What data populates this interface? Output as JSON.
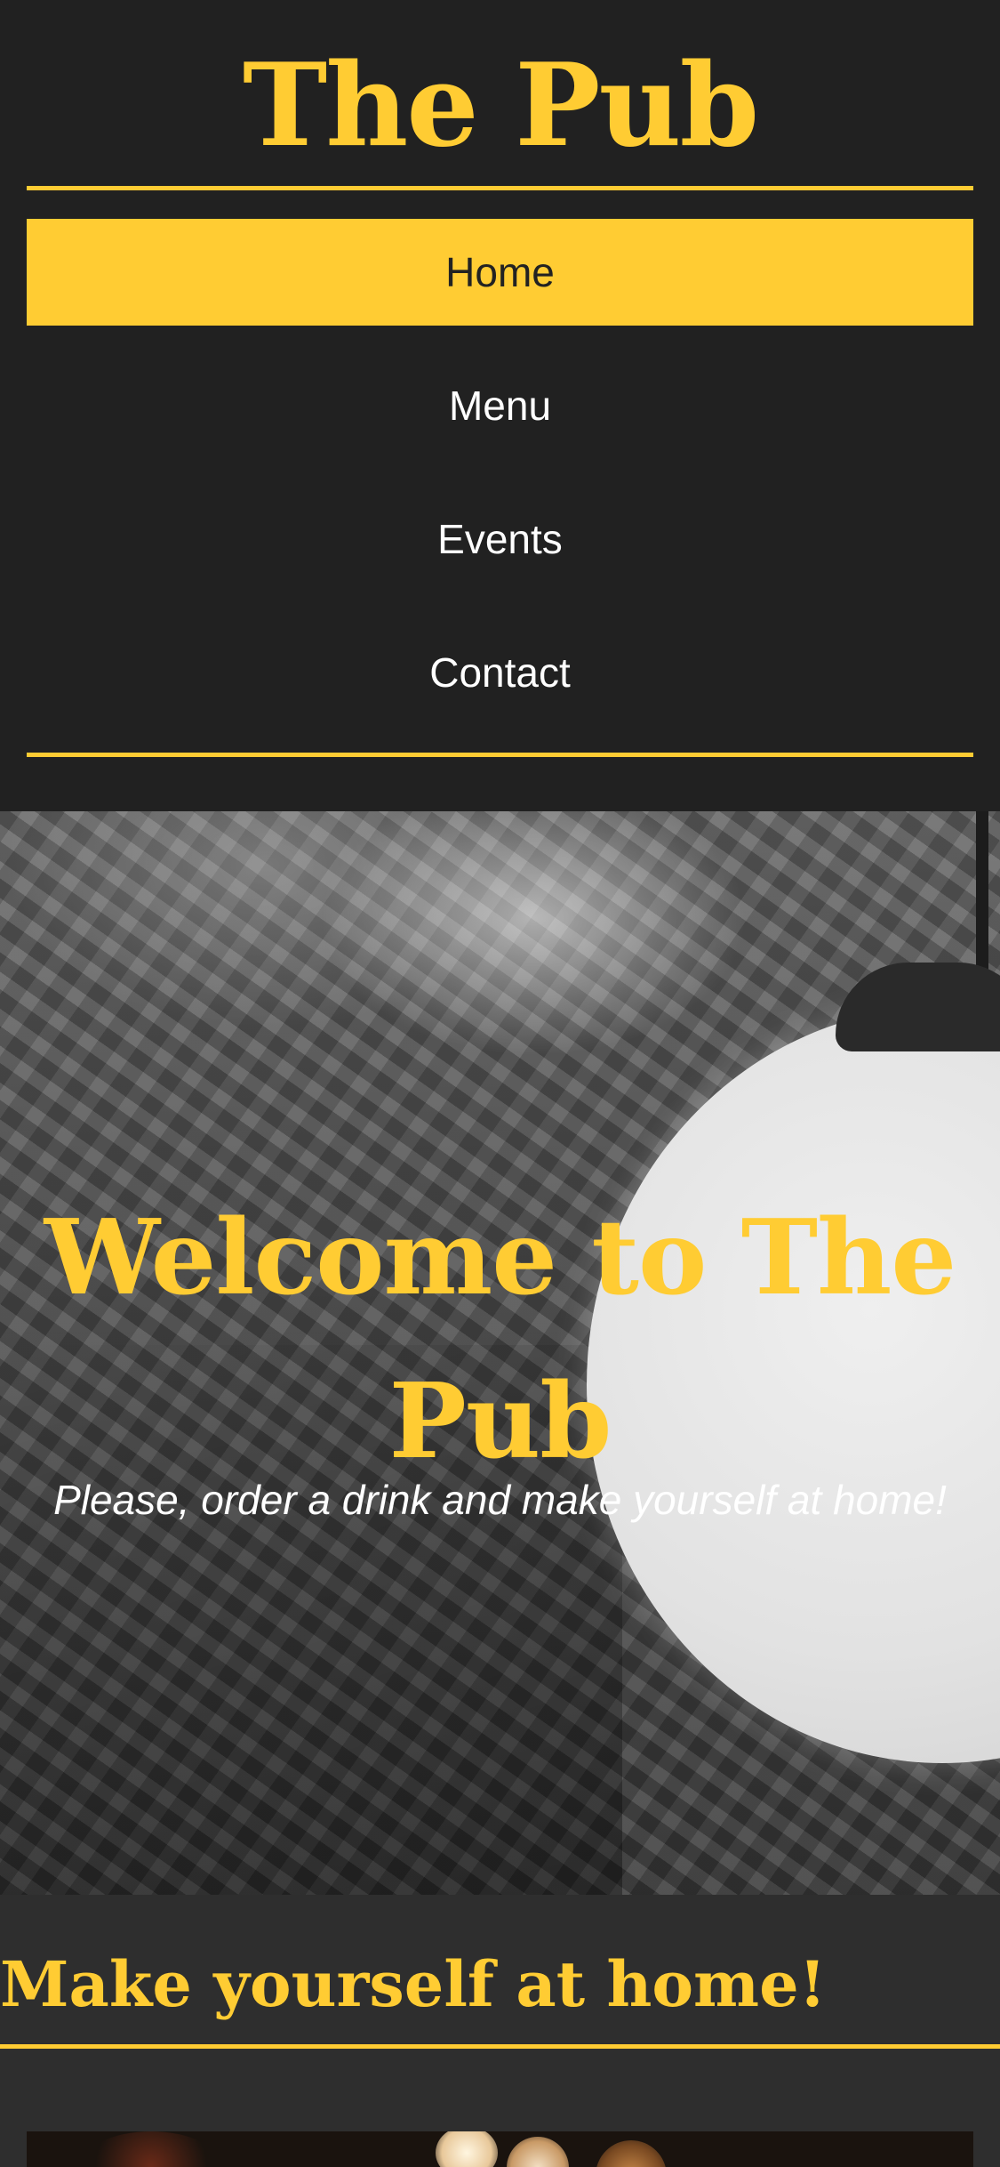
{
  "header": {
    "site_title": "The Pub"
  },
  "nav": {
    "items": [
      {
        "label": "Home",
        "active": true
      },
      {
        "label": "Menu",
        "active": false
      },
      {
        "label": "Events",
        "active": false
      },
      {
        "label": "Contact",
        "active": false
      }
    ]
  },
  "hero": {
    "heading": "Welcome to The Pub",
    "tagline": "Please, order a drink and make yourself at home!"
  },
  "section": {
    "heading": "Make yourself at home!"
  },
  "colors": {
    "accent": "#ffcc33",
    "background": "#222222",
    "section_background": "#2e2e2e",
    "text": "#ffffff"
  }
}
